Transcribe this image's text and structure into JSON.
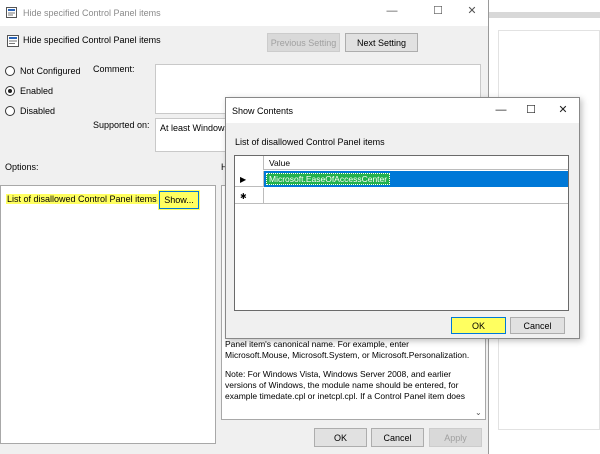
{
  "window": {
    "title": "Hide specified Control Panel items",
    "minimize": "—",
    "maximize": "☐",
    "close": "✕"
  },
  "header": {
    "policy_title": "Hide specified Control Panel items",
    "previous_label": "Previous Setting",
    "next_label": "Next Setting"
  },
  "state": {
    "not_configured": "Not Configured",
    "enabled": "Enabled",
    "disabled": "Disabled",
    "selected": "Enabled"
  },
  "fields": {
    "comment_label": "Comment:",
    "supported_label": "Supported on:",
    "supported_value": "At least Windows"
  },
  "options": {
    "label": "Options:",
    "item_label": "List of disallowed Control Panel items",
    "show_label": "Show..."
  },
  "help": {
    "label": "H",
    "paragraphs": [
      "Panel item's canonical name. For example, enter Microsoft.Mouse, Microsoft.System, or Microsoft.Personalization.",
      "Note: For Windows Vista, Windows Server 2008, and earlier versions of Windows, the module name should be entered, for example timedate.cpl or inetcpl.cpl. If a Control Panel item does"
    ],
    "scroll_down": "⌄"
  },
  "footer": {
    "ok": "OK",
    "cancel": "Cancel",
    "apply": "Apply"
  },
  "dialog": {
    "title": "Show Contents",
    "minimize": "—",
    "maximize": "☐",
    "close": "✕",
    "caption": "List of disallowed Control Panel items",
    "column_header": "Value",
    "rows": [
      {
        "marker": "▶",
        "value": "Microsoft.EaseOfAccessCenter"
      },
      {
        "marker": "✱",
        "value": ""
      }
    ],
    "ok": "OK",
    "cancel": "Cancel"
  },
  "colors": {
    "highlight": "#ffff60",
    "selection": "#0078d7",
    "value_highlight": "#22b14c"
  }
}
